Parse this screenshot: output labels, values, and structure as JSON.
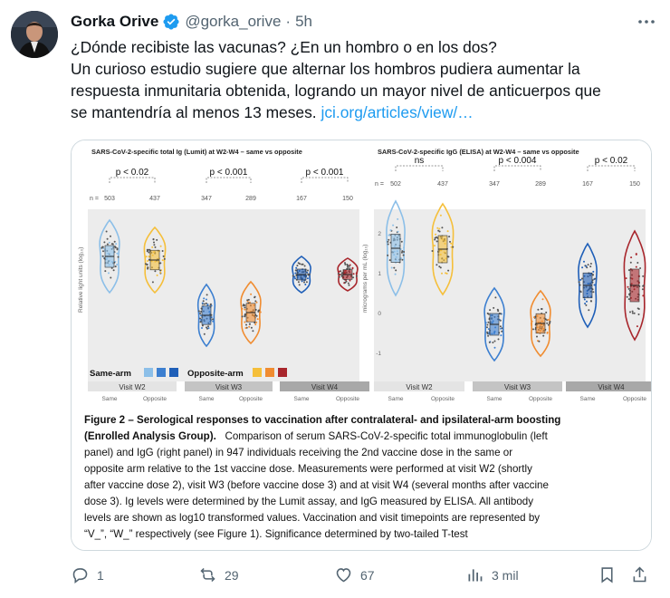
{
  "tweet": {
    "author_name": "Gorka Orive",
    "handle": "@gorka_orive",
    "separator": "·",
    "time": "5h",
    "lines": [
      "¿Dónde recibiste las vacunas? ¿En un hombro o en los dos?",
      "Un curioso estudio sugiere que alternar los hombros pudiera aumentar la",
      "respuesta inmunitaria obtenida, logrando un mayor nivel de anticuerpos que",
      "se mantendría al menos 13 meses."
    ],
    "link": "jci.org/articles/view/…"
  },
  "figure": {
    "left_title": "SARS-CoV-2-specific total Ig (Lumit) at W2-W4 – same vs opposite",
    "right_title": "SARS-CoV-2-specific IgG (ELISA) at W2-W4 – same vs opposite",
    "left_ylabel": "Relative light units (log₁₀)",
    "right_ylabel": "micrograms per mL (log₁₀)",
    "left_pvals": [
      "p < 0.02",
      "p < 0.001",
      "p < 0.001"
    ],
    "right_pvals": [
      "ns",
      "p < 0.004",
      "p < 0.02"
    ],
    "n_label": "n =",
    "left_n": [
      "503",
      "437",
      "347",
      "289",
      "167",
      "150"
    ],
    "right_n": [
      "502",
      "437",
      "347",
      "289",
      "167",
      "150"
    ],
    "right_yticks": [
      "2",
      "1",
      "0",
      "-1"
    ],
    "visits": [
      "Visit W2",
      "Visit W3",
      "Visit W4"
    ],
    "arms": [
      "Same",
      "Opposite"
    ],
    "legend_same": "Same-arm",
    "legend_opposite": "Opposite-arm",
    "colors": {
      "same": [
        "#8cbfe8",
        "#3c7fd0",
        "#1f5fb8"
      ],
      "opposite": [
        "#f5bf3a",
        "#f08c30",
        "#a8262c"
      ]
    },
    "caption_title": "Figure 2 – Serological responses to vaccination after contralateral- and ipsilateral-arm boosting (Enrolled Analysis Group).",
    "caption_lines": [
      "Comparison of serum SARS-CoV-2-specific total immunoglobulin (left",
      "panel) and IgG (right panel) in 947 individuals receiving the 2nd vaccine dose in the same or",
      "opposite arm relative to the 1st vaccine dose. Measurements were performed at visit W2 (shortly",
      "after vaccine dose 2), visit W3 (before vaccine dose 3) and at visit W4 (several months after vaccine",
      "dose 3). Ig levels were determined by the Lumit assay, and IgG measured by ELISA. All antibody",
      "levels are shown as log10 transformed values. Vaccination and visit timepoints are represented by",
      "“V_”, “W_” respectively (see Figure 1). Significance determined by two-tailed T-test"
    ]
  },
  "actions": {
    "replies": "1",
    "retweets": "29",
    "likes": "67",
    "views": "3 mil"
  },
  "chart_data": [
    {
      "type": "violin",
      "title": "SARS-CoV-2-specific total Ig (Lumit) at W2-W4 – same vs opposite",
      "ylabel": "Relative light units (log₁₀)",
      "categories": [
        "Visit W2 Same",
        "Visit W2 Opposite",
        "Visit W3 Same",
        "Visit W3 Opposite",
        "Visit W4 Same",
        "Visit W4 Opposite"
      ],
      "n": [
        503,
        437,
        347,
        289,
        167,
        150
      ],
      "significance": [
        "p < 0.02",
        "p < 0.001",
        "p < 0.001"
      ]
    },
    {
      "type": "violin",
      "title": "SARS-CoV-2-specific IgG (ELISA) at W2-W4 – same vs opposite",
      "ylabel": "micrograms per mL (log₁₀)",
      "yticks": [
        2,
        1,
        0,
        -1
      ],
      "categories": [
        "Visit W2 Same",
        "Visit W2 Opposite",
        "Visit W3 Same",
        "Visit W3 Opposite",
        "Visit W4 Same",
        "Visit W4 Opposite"
      ],
      "n": [
        502,
        437,
        347,
        289,
        167,
        150
      ],
      "significance": [
        "ns",
        "p < 0.004",
        "p < 0.02"
      ]
    }
  ]
}
